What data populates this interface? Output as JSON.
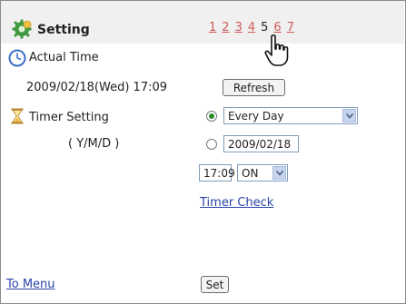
{
  "header": {
    "title": "Setting",
    "pages": [
      "1",
      "2",
      "3",
      "4",
      "5",
      "6",
      "7"
    ],
    "current_page": "5"
  },
  "actual_time": {
    "label": "Actual Time",
    "datetime": "2009/02/18(Wed) 17:09",
    "refresh_label": "Refresh"
  },
  "timer": {
    "label": "Timer Setting",
    "date_format": "( Y/M/D )",
    "repeat_option": "Every Day",
    "date_value": "2009/02/18",
    "time_value": "17:09",
    "state_value": "ON",
    "check_label": "Timer Check"
  },
  "footer": {
    "menu_link": "To Menu",
    "set_label": "Set"
  }
}
